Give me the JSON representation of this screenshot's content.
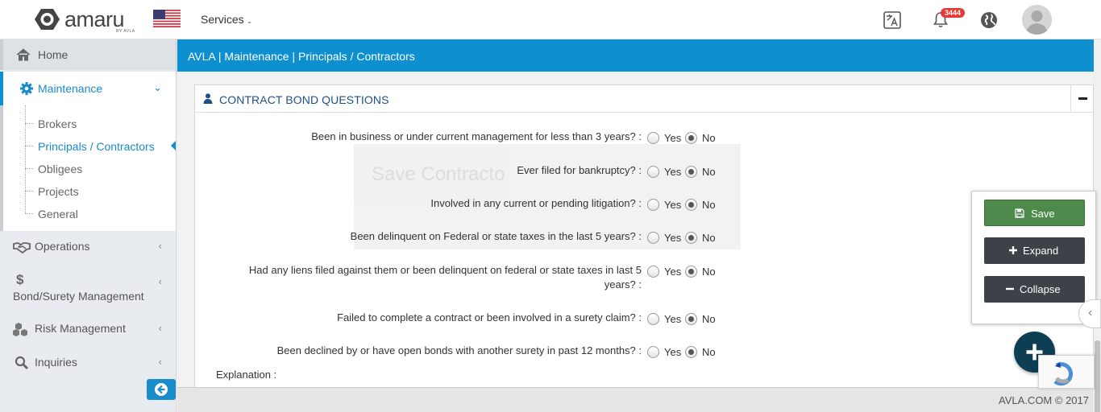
{
  "brand": {
    "name": "amaru",
    "sub": "BY AVLA"
  },
  "topbar": {
    "services_label": "Services",
    "notification_count": "3444"
  },
  "sidebar": {
    "home": "Home",
    "maintenance": "Maintenance",
    "sub_items": [
      "Brokers",
      "Principals / Contractors",
      "Obligees",
      "Projects",
      "General"
    ],
    "operations": "Operations",
    "bond": "Bond/Surety Management",
    "risk": "Risk Management",
    "inquiries": "Inquiries"
  },
  "breadcrumb": "AVLA | Maintenance | Principals / Contractors",
  "panel": {
    "title": "CONTRACT BOND QUESTIONS",
    "ghost_title": "Save Contracto"
  },
  "radio_labels": {
    "yes": "Yes",
    "no": "No"
  },
  "questions": [
    {
      "text": "Been in business or under current management for less than 3 years? :",
      "answer": "No"
    },
    {
      "text": "Ever filed for bankruptcy? :",
      "answer": "No"
    },
    {
      "text": "Involved in any current or pending litigation? :",
      "answer": "No"
    },
    {
      "text": "Been delinquent on Federal or state taxes in the last 5 years? :",
      "answer": "No"
    },
    {
      "text": "Had any liens filed against them or been delinquent on federal or state taxes in last 5 years? :",
      "answer": "No"
    },
    {
      "text": "Failed to complete a contract or been involved in a surety claim? :",
      "answer": "No"
    },
    {
      "text": "Been declined by or have open bonds with another surety in past 12 months? :",
      "answer": "No"
    }
  ],
  "explanation_label": "Explanation :",
  "actions": {
    "save": "Save",
    "expand": "Expand",
    "collapse": "Collapse"
  },
  "footer": "AVLA.COM © 2017",
  "colors": {
    "accent": "#0e8fd0",
    "title": "#1f4f8a",
    "save": "#4e8a4c",
    "dark_btn": "#3d4248",
    "fab": "#0d3e53"
  }
}
